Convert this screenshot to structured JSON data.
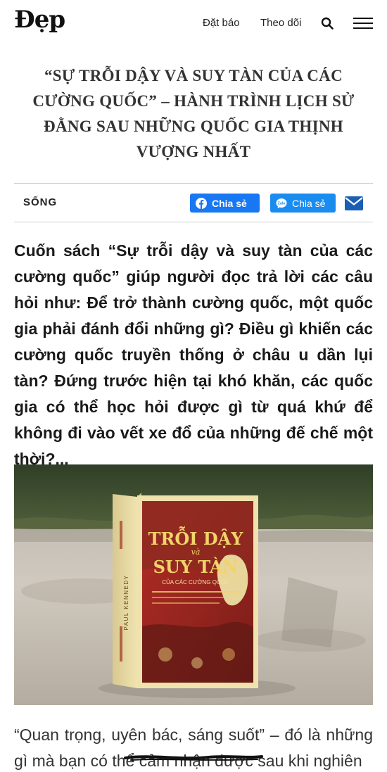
{
  "header": {
    "logo": "Đẹp",
    "subscribe_label": "Đặt báo",
    "follow_label": "Theo dõi"
  },
  "article": {
    "title": "“SỰ TRỖI DẬY VÀ SUY TÀN CỦA CÁC CƯỜNG QUỐC” – HÀNH TRÌNH LỊCH SỬ ĐẰNG SAU NHỮNG QUỐC GIA THỊNH VƯỢNG NHẤT",
    "category": "SỐNG",
    "lead": "Cuốn sách “Sự trỗi dậy và suy tàn của các cường quốc” giúp người đọc trả lời các câu hỏi như: Để trở thành cường quốc, một quốc gia phải đánh đổi những gì? Điều gì khiến các cường quốc truyền thống ở châu u dần lụi tàn? Đứng trước hiện tại khó khăn, các quốc gia có thể học hỏi được gì từ quá khứ để không đi vào vết xe đổ của những đế chế một thời?...",
    "body_line": "“Quan trọng, uyên bác, sáng suốt” – đó là những gì mà bạn có thể cảm nhận được sau khi nghiên"
  },
  "share": {
    "facebook_label": "Chia sẻ",
    "zalo_label": "Chia sẻ",
    "facebook_color": "#1877f2",
    "zalo_color": "#1a8cf0"
  },
  "book": {
    "title_line1": "TRỖI DẬY",
    "title_and": "và",
    "title_line2": "SUY TÀN",
    "subtitle": "CỦA CÁC CƯỜNG QUỐC",
    "author": "PAUL KENNEDY"
  }
}
